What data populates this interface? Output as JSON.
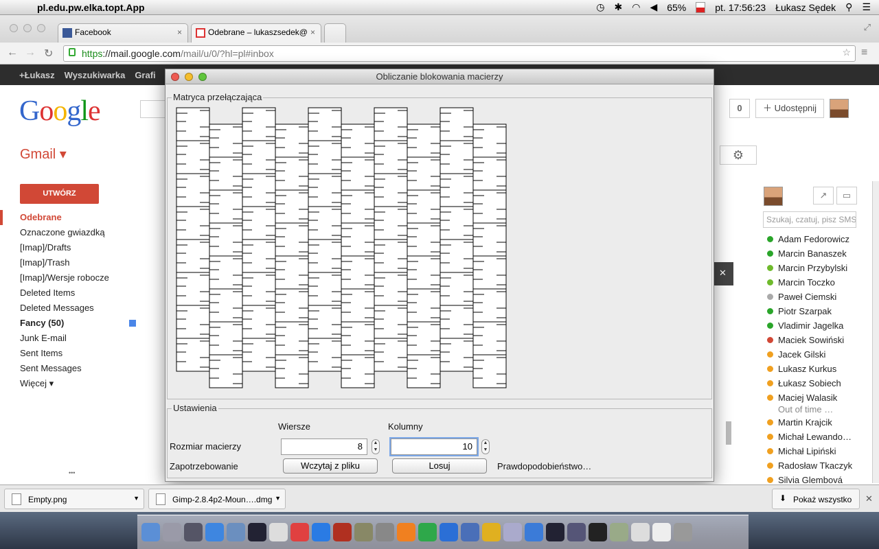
{
  "menubar": {
    "app_name": "pl.edu.pw.elka.topt.App",
    "battery": "65%",
    "clock": "pt. 17:56:23",
    "user": "Łukasz Sędek"
  },
  "browser": {
    "tabs": [
      {
        "label": "Facebook"
      },
      {
        "label": "Odebrane – lukaszsedek@"
      }
    ],
    "url": {
      "scheme": "https",
      "host": "://mail.google.com",
      "path": "/mail/u/0/?hl=pl#inbox"
    }
  },
  "gbar": {
    "items": [
      "+Łukasz",
      "Wyszukiwarka",
      "Grafi"
    ]
  },
  "gmail": {
    "logo": [
      "G",
      "o",
      "o",
      "g",
      "l",
      "e"
    ],
    "label": "Gmail ▾",
    "compose": "UTWÓRZ",
    "share_count": "0",
    "share_label": "Udostępnij",
    "folders": [
      {
        "label": "Odebrane",
        "style": "sel"
      },
      {
        "label": "Oznaczone gwiazdką",
        "style": ""
      },
      {
        "label": "[Imap]/Drafts",
        "style": ""
      },
      {
        "label": "[Imap]/Trash",
        "style": ""
      },
      {
        "label": "[Imap]/Wersje robocze",
        "style": ""
      },
      {
        "label": "Deleted Items",
        "style": ""
      },
      {
        "label": "Deleted Messages",
        "style": ""
      },
      {
        "label": "Fancy (50)",
        "style": "bold"
      },
      {
        "label": "Junk E-mail",
        "style": ""
      },
      {
        "label": "Sent Items",
        "style": ""
      },
      {
        "label": "Sent Messages",
        "style": ""
      },
      {
        "label": "Więcej ▾",
        "style": ""
      }
    ],
    "more_dots": "•••",
    "chat_search_placeholder": "Szukaj, czatuj, pisz SMS",
    "contacts": [
      {
        "name": "Adam Fedorowicz",
        "color": "#2aa52a"
      },
      {
        "name": "Marcin Banaszek",
        "color": "#2aa52a"
      },
      {
        "name": "Marcin Przybylski",
        "color": "#6fba2c"
      },
      {
        "name": "Marcin Toczko",
        "color": "#6fba2c"
      },
      {
        "name": "Paweł Ciemski",
        "color": "#aaaaaa"
      },
      {
        "name": "Piotr Szarpak",
        "color": "#2aa52a"
      },
      {
        "name": "Vladimir Jagelka",
        "color": "#2aa52a"
      },
      {
        "name": "Maciek Sowiński",
        "color": "#d14836"
      },
      {
        "name": "Jacek Gilski",
        "color": "#f0a020"
      },
      {
        "name": "Lukasz Kurkus",
        "color": "#f0a020"
      },
      {
        "name": "Łukasz Sobiech",
        "color": "#f0a020"
      },
      {
        "name": "Maciej Walasik",
        "color": "#f0a020"
      },
      {
        "name": "Martin Krajcik",
        "color": "#f0a020"
      },
      {
        "name": "Michał Lewando…",
        "color": "#f0a020"
      },
      {
        "name": "Michał Lipiński",
        "color": "#f0a020"
      },
      {
        "name": "Radosław Tkaczyk",
        "color": "#f0a020"
      },
      {
        "name": "Silvia Glembová",
        "color": "#f0a020"
      }
    ],
    "contact_status": "Out of time …"
  },
  "dialog": {
    "title": "Obliczanie blokowania macierzy",
    "matrix_legend": "Matryca przełączająca",
    "settings_legend": "Ustawienia",
    "rows_header": "Wiersze",
    "cols_header": "Kolumny",
    "size_label": "Rozmiar macierzy",
    "rows_value": "8",
    "cols_value": "10",
    "demand_label": "Zapotrzebowanie",
    "load_button": "Wczytaj z pliku",
    "random_button": "Losuj",
    "probability_label": "Prawdopodobieństwo…",
    "matrix": {
      "rows": 8,
      "cols": 10
    }
  },
  "downloads": {
    "items": [
      "Empty.png",
      "Gimp-2.8.4p2-Moun….dmg"
    ],
    "show_all": "Pokaż wszystko",
    "close": "✕"
  },
  "dock": {
    "colors": [
      "#5b8fd6",
      "#9a9aa8",
      "#556",
      "#3e86e0",
      "#6b8fbf",
      "#223",
      "#ddd",
      "#e04040",
      "#2a7be4",
      "#b03020",
      "#886",
      "#888",
      "#f08020",
      "#2ea84a",
      "#2b6fd6",
      "#4a6fb8",
      "#e0b020",
      "#aac",
      "#3b7bd8",
      "#223",
      "#557",
      "#222",
      "#9a8",
      "#ddd",
      "#eee",
      "#999"
    ]
  }
}
